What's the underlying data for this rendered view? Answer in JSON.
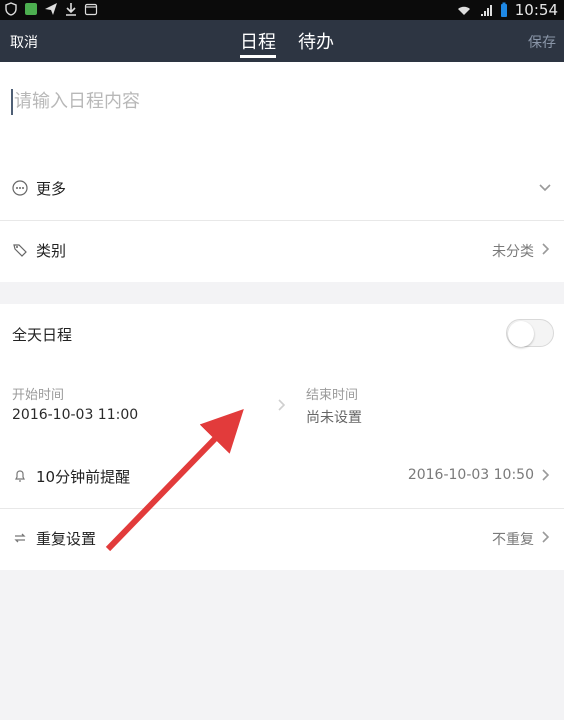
{
  "status_bar": {
    "time": "10:54",
    "left_icons": [
      "shield-icon",
      "app-icon",
      "send-icon",
      "download-icon",
      "calendar-icon"
    ],
    "right_icons": [
      "wifi-icon",
      "signal-icon",
      "battery-icon"
    ]
  },
  "navbar": {
    "cancel_label": "取消",
    "tabs": [
      "日程",
      "待办"
    ],
    "active_tab": 0,
    "save_label": "保存"
  },
  "input": {
    "placeholder": "请输入日程内容"
  },
  "more": {
    "label": "更多"
  },
  "category": {
    "label": "类别",
    "value": "未分类"
  },
  "all_day": {
    "label": "全天日程",
    "enabled": false
  },
  "time": {
    "start_label": "开始时间",
    "start_value": "2016-10-03 11:00",
    "end_label": "结束时间",
    "end_value": "尚未设置"
  },
  "reminder": {
    "label": "10分钟前提醒",
    "value": "2016-10-03 10:50"
  },
  "repeat": {
    "label": "重复设置",
    "value": "不重复"
  },
  "colors": {
    "nav_bg": "#2d3542",
    "background": "#f3f3f5",
    "annotation_arrow": "#e23b3b"
  }
}
